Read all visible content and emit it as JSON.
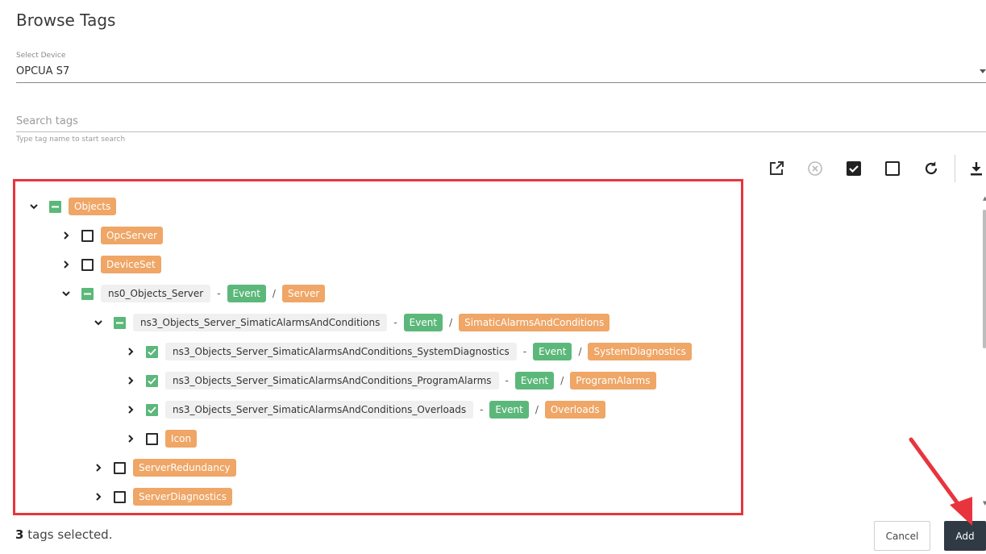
{
  "dialog": {
    "title": "Browse Tags"
  },
  "device": {
    "label": "Select Device",
    "value": "OPCUA S7"
  },
  "search": {
    "placeholder": "Search tags",
    "hint": "Type tag name to start search"
  },
  "toolbar": {
    "icons": [
      "open-external-icon",
      "clear-circle-icon",
      "check-all-icon",
      "uncheck-all-icon",
      "refresh-icon",
      "download-icon"
    ]
  },
  "tree": {
    "rows": [
      {
        "chip": "Objects"
      },
      {
        "chip": "OpcServer"
      },
      {
        "chip": "DeviceSet"
      },
      {
        "node": "ns0_Objects_Server",
        "type": "Event",
        "name": "Server"
      },
      {
        "node": "ns3_Objects_Server_SimaticAlarmsAndConditions",
        "type": "Event",
        "name": "SimaticAlarmsAndConditions"
      },
      {
        "node": "ns3_Objects_Server_SimaticAlarmsAndConditions_SystemDiagnostics",
        "type": "Event",
        "name": "SystemDiagnostics"
      },
      {
        "node": "ns3_Objects_Server_SimaticAlarmsAndConditions_ProgramAlarms",
        "type": "Event",
        "name": "ProgramAlarms"
      },
      {
        "node": "ns3_Objects_Server_SimaticAlarmsAndConditions_Overloads",
        "type": "Event",
        "name": "Overloads"
      },
      {
        "chip": "Icon"
      },
      {
        "chip": "ServerRedundancy"
      },
      {
        "chip": "ServerDiagnostics"
      }
    ],
    "separators": {
      "dash": "-",
      "slash": "/"
    }
  },
  "footer": {
    "selected_count": "3",
    "selected_text": " tags selected.",
    "cancel_label": "Cancel",
    "add_label": "Add"
  },
  "colors": {
    "accent_orange": "#efa666",
    "accent_green": "#5cb87a",
    "highlight_red": "#e8343d",
    "primary_dark": "#2f3a45"
  }
}
